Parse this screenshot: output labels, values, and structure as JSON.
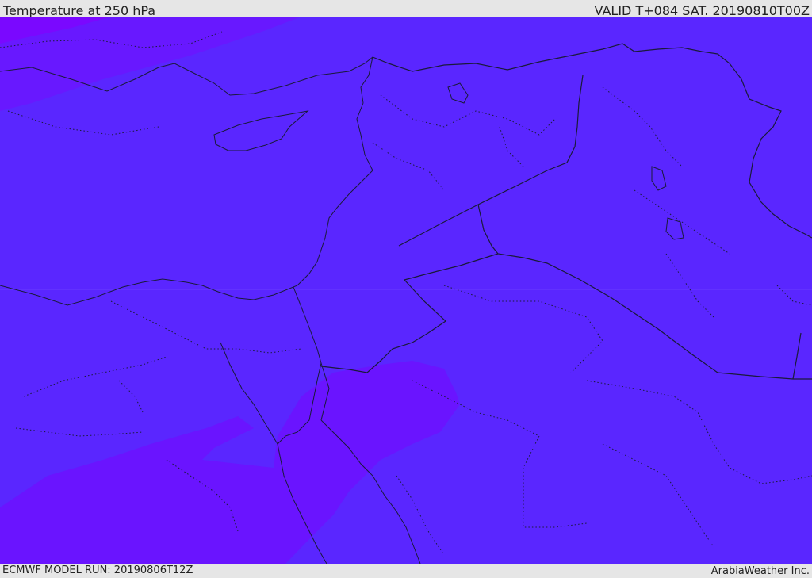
{
  "header": {
    "title": "Temperature at 250 hPa",
    "valid": "VALID T+084 SAT. 20190810T00Z"
  },
  "footer": {
    "model_run": "ECMWF MODEL RUN: 20190806T12Z",
    "credit": "ArabiaWeather Inc."
  },
  "map": {
    "base_color": "#5a26ff",
    "warm_color": "#6a14ff",
    "coldest_color": "#7a08ff",
    "border_color": "#1a1a3a"
  }
}
